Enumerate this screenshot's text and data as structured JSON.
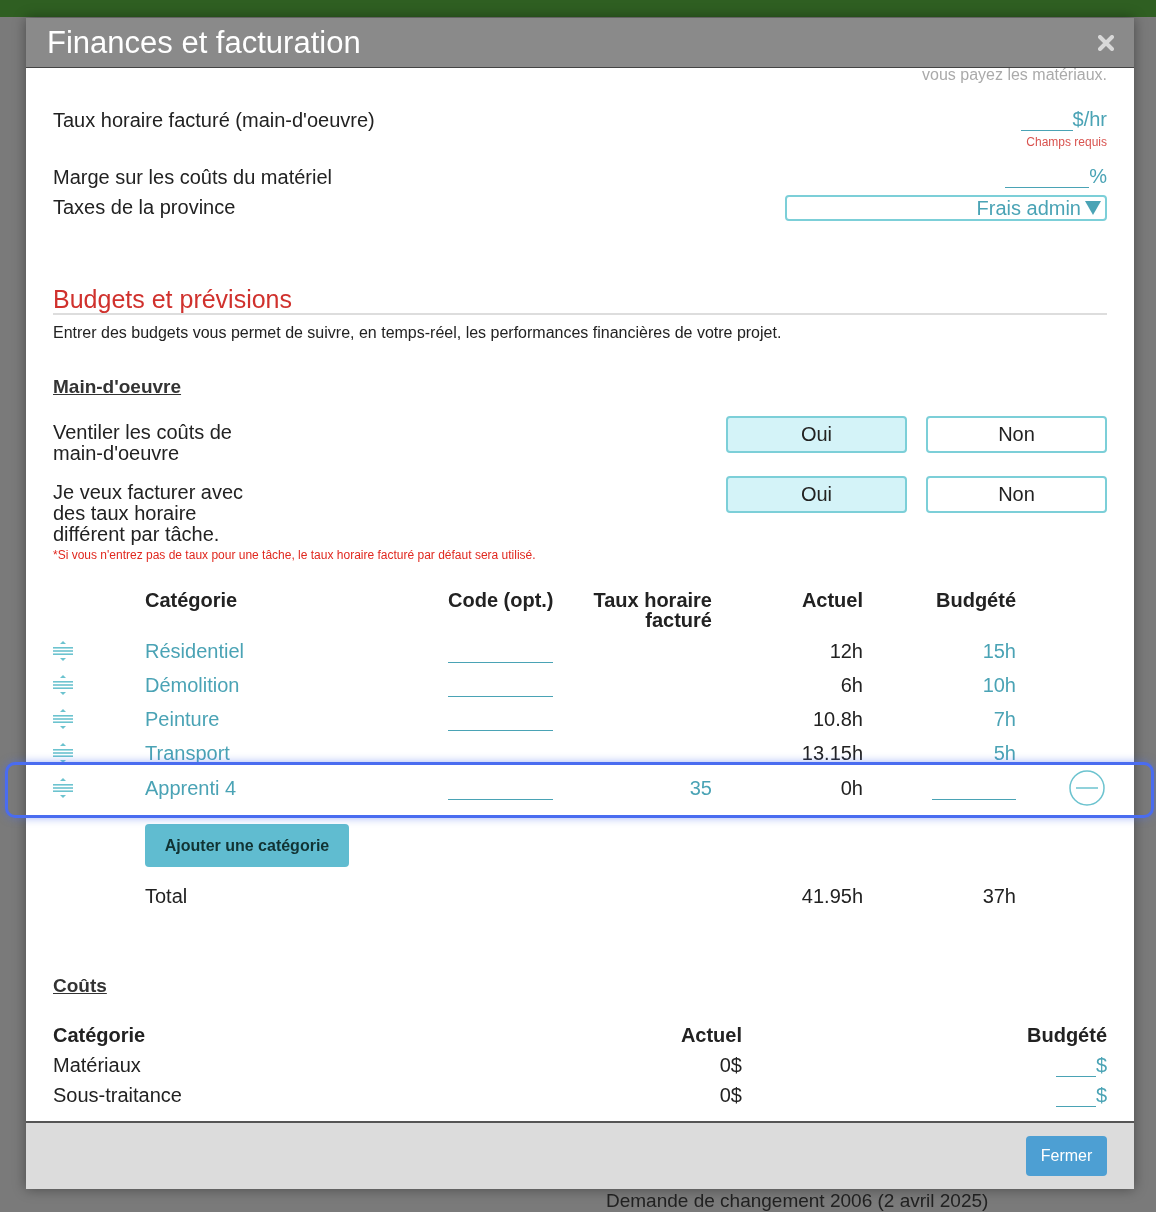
{
  "background": {
    "bottom_text": "Demande de changement 2006 (2 avril 2025)"
  },
  "dialog": {
    "title": "Finances et facturation"
  },
  "billing": {
    "note": "vous payez les matériaux.",
    "fields": [
      {
        "kind": "input",
        "label": "Taux horaire facturé (main-d'oeuvre)",
        "unit": "$/hr",
        "error": "Champs requis"
      },
      {
        "kind": "input",
        "label": "Marge sur les coûts du matériel",
        "unit": "%"
      },
      {
        "kind": "select",
        "label": "Taxes de la province",
        "value": "Frais admin"
      }
    ]
  },
  "budgets": {
    "title": "Budgets et prévisions",
    "description": "Entrer des budgets vous permet de suivre, en temps-réel, les performances financières de votre projet.",
    "labour": {
      "title": "Main-d'oeuvre",
      "questions": [
        {
          "label": "Ventiler les coûts de main-d'oeuvre",
          "options": [
            {
              "label": "Oui",
              "selected": true
            },
            {
              "label": "Non",
              "selected": false
            }
          ]
        },
        {
          "label": "Je veux facturer avec des taux horaire différent par tâche.",
          "note": "*Si vous n'entrez pas de taux pour une tâche, le taux horaire facturé par défaut sera utilisé.",
          "options": [
            {
              "label": "Oui",
              "selected": true
            },
            {
              "label": "Non",
              "selected": false
            }
          ]
        }
      ],
      "columns": [
        "Catégorie",
        "Code (opt.)",
        "Taux horaire facturé",
        "Actuel",
        "Budgété"
      ],
      "rows": [
        {
          "category": "Résidentiel",
          "code_field": true,
          "actual": "12h",
          "budget": "15h",
          "focused": false
        },
        {
          "category": "Démolition",
          "code_field": true,
          "actual": "6h",
          "budget": "10h",
          "focused": false
        },
        {
          "category": "Peinture",
          "code_field": true,
          "actual": "10.8h",
          "budget": "7h",
          "focused": false
        },
        {
          "category": "Transport",
          "code_field": false,
          "actual": "13.15h",
          "budget": "5h",
          "focused": false
        },
        {
          "category": "Apprenti 4",
          "code_field": true,
          "rate": "35",
          "actual": "0h",
          "focused": true
        }
      ],
      "add_button": "Ajouter une catégorie",
      "total": {
        "label": "Total",
        "actual": "41.95h",
        "budget": "37h"
      }
    },
    "costs": {
      "title": "Coûts",
      "columns": [
        "Catégorie",
        "Actuel",
        "Budgété"
      ],
      "rows": [
        {
          "category": "Matériaux",
          "actual": "0$",
          "unit": "$"
        },
        {
          "category": "Sous-traitance",
          "actual": "0$",
          "unit": "$"
        }
      ]
    }
  },
  "footer": {
    "close_button": "Fermer"
  }
}
